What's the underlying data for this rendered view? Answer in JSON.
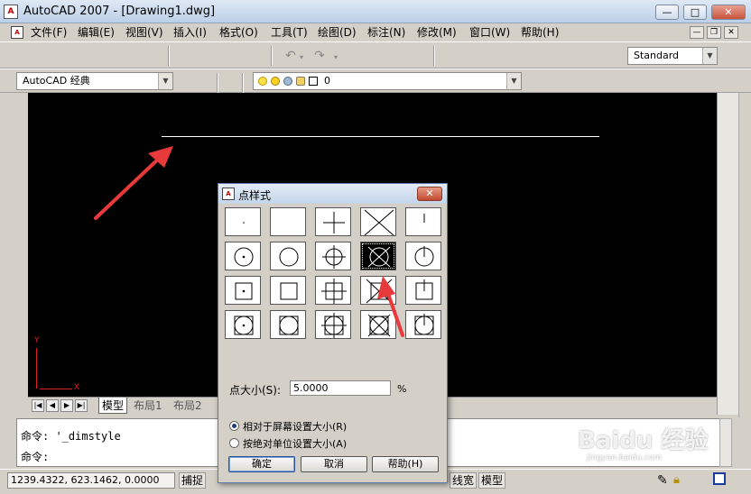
{
  "window": {
    "title": "AutoCAD 2007 - [Drawing1.dwg]",
    "minimize_label": "—",
    "maximize_label": "□",
    "close_label": "✕"
  },
  "menubar": {
    "items": [
      "文件(F)",
      "编辑(E)",
      "视图(V)",
      "插入(I)",
      "格式(O)",
      "工具(T)",
      "绘图(D)",
      "标注(N)",
      "修改(M)",
      "窗口(W)",
      "帮助(H)"
    ]
  },
  "toolbars": {
    "text_style": "Standard",
    "workspace": "AutoCAD 经典",
    "layer": "0"
  },
  "tabs": [
    "模型",
    "布局1",
    "布局2"
  ],
  "ucs": {
    "x_label": "X",
    "y_label": "Y"
  },
  "command": {
    "line1": "命令: '_dimstyle",
    "line2": "命令:"
  },
  "status": {
    "coordinates": "1239.4322, 623.1462, 0.0000",
    "snap": "捕捉",
    "lineweight": "线宽",
    "model": "模型"
  },
  "dialog": {
    "title": "点样式",
    "close_label": "✕",
    "size_label": "点大小(S):",
    "size_value": "5.0000",
    "size_unit": "%",
    "option_relative": "相对于屏幕设置大小(R)",
    "option_absolute": "按绝对单位设置大小(A)",
    "ok": "确定",
    "cancel": "取消",
    "help": "帮助(H)",
    "selected_style_index": 8
  },
  "watermark": {
    "brand": "Baidu 经验",
    "url": "jingyan.baidu.com"
  },
  "colors": {
    "canvas": "#000000",
    "annotation_arrow": "#e83a3a",
    "ucs": "#dd2222"
  }
}
